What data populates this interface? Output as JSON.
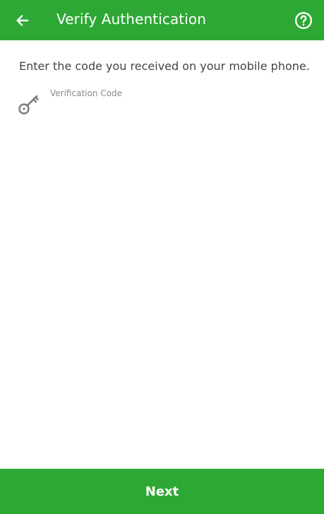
{
  "header": {
    "back_icon": "arrow-left-icon",
    "title": "Verify Authentication",
    "help_icon": "help-circle-icon"
  },
  "main": {
    "instruction": "Enter the code you received on your mobile phone.",
    "code_field": {
      "icon": "key-icon",
      "label": "Verification Code",
      "value": "",
      "placeholder": ""
    }
  },
  "footer": {
    "next_label": "Next"
  },
  "colors": {
    "brand_green": "#2ea835",
    "text": "#444444",
    "label": "#8a8a8a",
    "icon_gray": "#7a7a7a"
  }
}
